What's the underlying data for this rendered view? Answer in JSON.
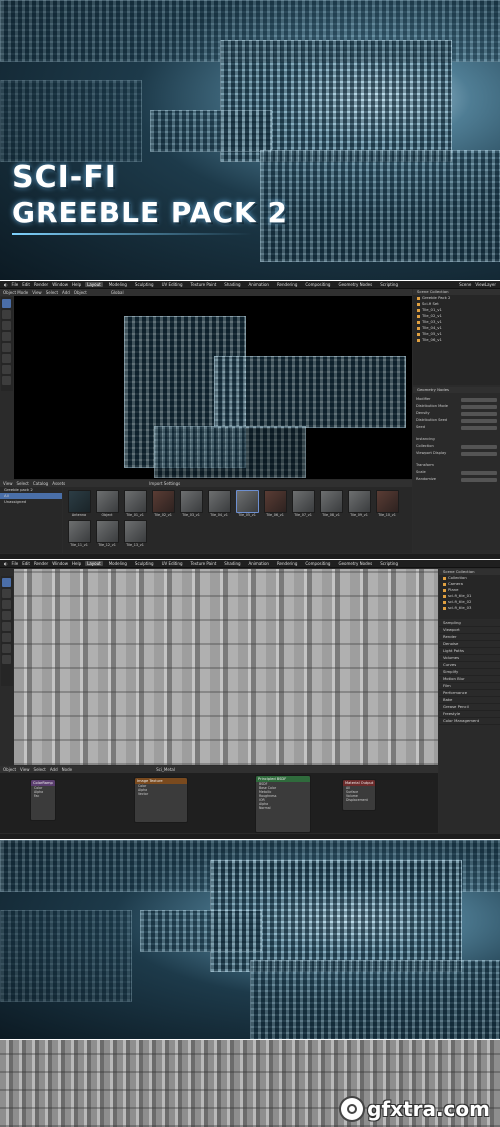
{
  "hero": {
    "title_line1": "SCI-FI",
    "title_line2": "GREEBLE PACK 2"
  },
  "screen1": {
    "menu": [
      "File",
      "Edit",
      "Render",
      "Window",
      "Help"
    ],
    "workspaces": [
      "Layout",
      "Modeling",
      "Sculpting",
      "UV Editing",
      "Texture Paint",
      "Shading",
      "Animation",
      "Rendering",
      "Compositing",
      "Geometry Nodes",
      "Scripting"
    ],
    "active_workspace": "Layout",
    "scene_label": "Scene",
    "view_layer_label": "ViewLayer",
    "viewport_header": [
      "Object Mode",
      "View",
      "Select",
      "Add",
      "Object"
    ],
    "orientation": "Global",
    "outliner_title": "Scene Collection",
    "outliner_rows": [
      "Greeble Pack 2",
      "Sci-fi Set",
      "Tile_01_v1",
      "Tile_02_v1",
      "Tile_03_v1",
      "Tile_04_v1",
      "Tile_05_v1",
      "Tile_06_v1"
    ],
    "asset_header": [
      "View",
      "Select",
      "Catalog",
      "Assets"
    ],
    "asset_library": "Greeble pack 2",
    "catalog_items": [
      "All",
      "Unassigned"
    ],
    "asset_settings": "Import Settings",
    "assets": [
      "Antenna",
      "Object",
      "Tile_01_v1",
      "Tile_02_v1",
      "Tile_03_v1",
      "Tile_04_v1",
      "Tile_05_v1",
      "Tile_06_v1",
      "Tile_07_v1",
      "Tile_08_v1",
      "Tile_09_v1",
      "Tile_10_v1",
      "Tile_11_v1",
      "Tile_12_v1",
      "Tile_13_v1"
    ],
    "props_title": "Geometry Nodes",
    "props": [
      "Modifier",
      "Distribution Mode",
      "Density",
      "Distribution Seed",
      "Seed",
      "Instancing",
      "Collection",
      "Viewport Display",
      "Transform",
      "Scale",
      "Randomize"
    ]
  },
  "screen2": {
    "menu": [
      "File",
      "Edit",
      "Render",
      "Window",
      "Help"
    ],
    "workspaces": [
      "Layout",
      "Modeling",
      "Sculpting",
      "UV Editing",
      "Texture Paint",
      "Shading",
      "Animation",
      "Rendering",
      "Compositing",
      "Geometry Nodes",
      "Scripting"
    ],
    "active_workspace": "Layout",
    "outliner_title": "Scene Collection",
    "outliner_rows": [
      "Collection",
      "Camera",
      "Plane",
      "sci-fi_tile_01",
      "sci-fi_tile_02",
      "sci-fi_tile_03"
    ],
    "render_props": [
      "Sampling",
      "Viewport",
      "Render",
      "Denoise",
      "Light Paths",
      "Volumes",
      "Curves",
      "Simplify",
      "Motion Blur",
      "Film",
      "Performance",
      "Bake",
      "Grease Pencil",
      "Freestyle",
      "Color Management"
    ],
    "node_header": [
      "Object",
      "View",
      "Select",
      "Add",
      "Node"
    ],
    "material_name": "Sci_Metal",
    "nodes": [
      {
        "title": "Principled BSDF",
        "sockets": [
          "BSDF",
          "Base Color",
          "Metallic",
          "Roughness",
          "IOR",
          "Alpha",
          "Normal"
        ]
      },
      {
        "title": "Material Output",
        "sockets": [
          "All",
          "Surface",
          "Volume",
          "Displacement"
        ]
      },
      {
        "title": "Image Texture",
        "sockets": [
          "Color",
          "Alpha",
          "Vector"
        ]
      },
      {
        "title": "ColorRamp",
        "sockets": [
          "Color",
          "Alpha",
          "Fac"
        ]
      }
    ]
  },
  "watermark": {
    "text": "gfxtra.com"
  }
}
